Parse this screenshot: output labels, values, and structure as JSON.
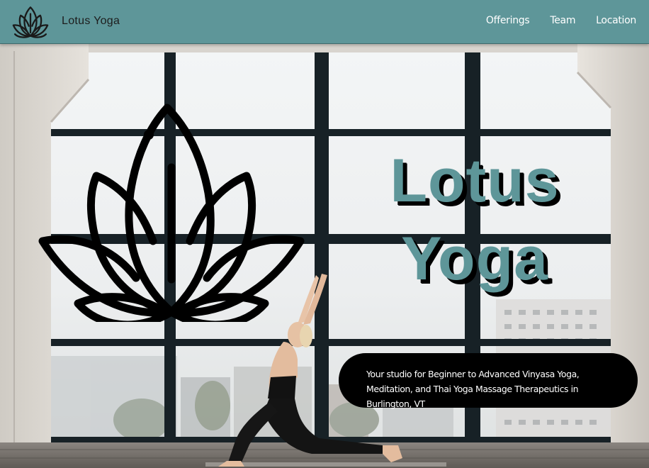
{
  "nav": {
    "brand": "Lotus Yoga",
    "links": [
      "Offerings",
      "Team",
      "Location"
    ],
    "logo_icon": "lotus-icon",
    "background_color": "#5e9699"
  },
  "hero": {
    "title_line1": "Lotus",
    "title_line2": "Yoga",
    "title_color": "#5e9699",
    "tagline": "Your studio for Beginner to Advanced Vinyasa Yoga, Meditation, and Thai Yoga Massage Therapeutics in Burlington, VT",
    "lotus_icon": "lotus-icon",
    "background_image": "yoga-studio-window-photo"
  }
}
